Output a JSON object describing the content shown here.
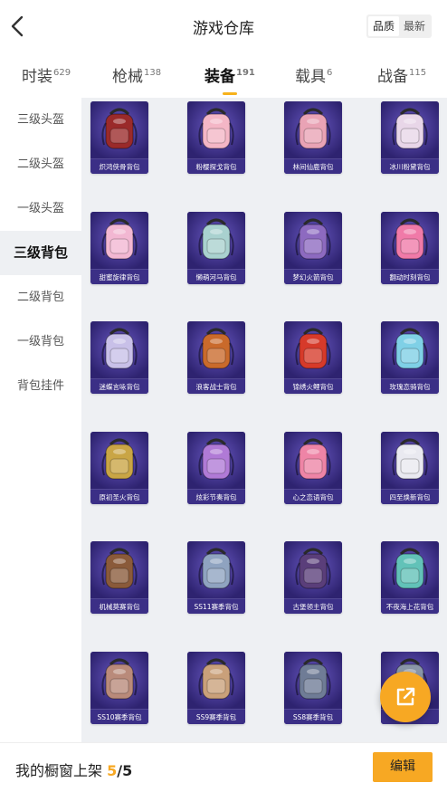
{
  "header": {
    "title": "游戏仓库",
    "sort_toggle": [
      "品质",
      "最新"
    ],
    "sort_active": 0
  },
  "tabs": [
    {
      "label": "时装",
      "count": "629"
    },
    {
      "label": "枪械",
      "count": "138"
    },
    {
      "label": "装备",
      "count": "191"
    },
    {
      "label": "载具",
      "count": "6"
    },
    {
      "label": "战备",
      "count": "115"
    }
  ],
  "active_tab": 2,
  "sidebar": {
    "items": [
      "三级头盔",
      "二级头盔",
      "一级头盔",
      "三级背包",
      "二级背包",
      "一级背包",
      "背包挂件"
    ],
    "active": 3
  },
  "items": [
    {
      "name": "炽鸿侠骨背包",
      "color": "#9a2a2a"
    },
    {
      "name": "粉樱探戈背包",
      "color": "#f4b6c6"
    },
    {
      "name": "林间仙鹿背包",
      "color": "#e9a3b5"
    },
    {
      "name": "冰川粉黛背包",
      "color": "#e8d6e8"
    },
    {
      "name": "甜蜜旋律背包",
      "color": "#f2b7d2"
    },
    {
      "name": "懒萌河马背包",
      "color": "#a9d1cf"
    },
    {
      "name": "梦幻火箭背包",
      "color": "#8d6ac0"
    },
    {
      "name": "翻动时刻背包",
      "color": "#f07aa8"
    },
    {
      "name": "迷蝶言咏背包",
      "color": "#c8c0e8"
    },
    {
      "name": "浪客战士背包",
      "color": "#c96a2b"
    },
    {
      "name": "锦绣火鲤背包",
      "color": "#d63a2a"
    },
    {
      "name": "玫瑰恋骑背包",
      "color": "#7fd0e6"
    },
    {
      "name": "原初圣火背包",
      "color": "#c9a545"
    },
    {
      "name": "炫彩节奏背包",
      "color": "#b07ad6"
    },
    {
      "name": "心之恋语背包",
      "color": "#ee84a6"
    },
    {
      "name": "四至焕新背包",
      "color": "#e9e9f0"
    },
    {
      "name": "机械莫赛背包",
      "color": "#8a5a3a"
    },
    {
      "name": "SS11赛季背包",
      "color": "#8fa3c0"
    },
    {
      "name": "古堡领主背包",
      "color": "#5a3e7a"
    },
    {
      "name": "不夜海上花背包",
      "color": "#62c2b8"
    },
    {
      "name": "SS10赛季背包",
      "color": "#b98a7a"
    },
    {
      "name": "SS9赛季背包",
      "color": "#c9a07a"
    },
    {
      "name": "SS8赛季背包",
      "color": "#6f7c96"
    },
    {
      "name": "",
      "color": "#8a96a8"
    }
  ],
  "bottom": {
    "label": "我的橱窗上架",
    "current": "5",
    "separator": "/",
    "total": "5",
    "edit_label": "编辑"
  },
  "colors": {
    "accent": "#f7a823",
    "card_bg": "#3b2f86",
    "sidebar_active_bg": "#eef0f3"
  }
}
